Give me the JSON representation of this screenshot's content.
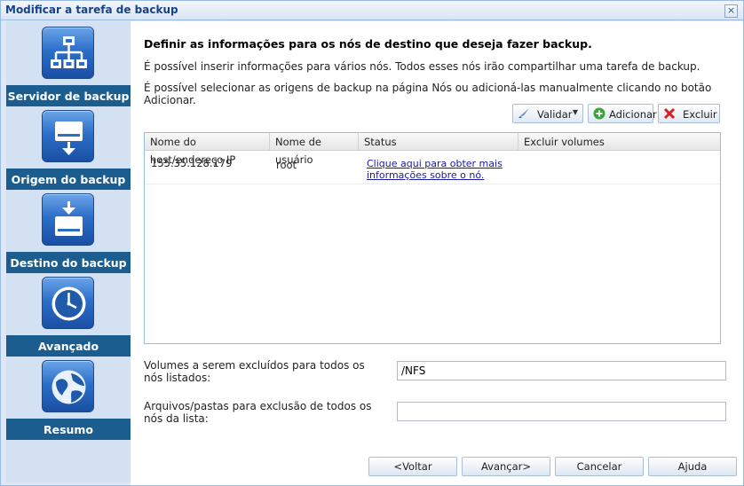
{
  "window": {
    "title": "Modificar a tarefa de backup",
    "close_symbol": "×"
  },
  "sidebar": {
    "steps": [
      {
        "label": "Servidor de backup",
        "icon": "network-icon"
      },
      {
        "label": "Origem do backup",
        "icon": "drive-download-icon"
      },
      {
        "label": "Destino do backup",
        "icon": "drive-upload-icon"
      },
      {
        "label": "Avançado",
        "icon": "clock-icon"
      },
      {
        "label": "Resumo",
        "icon": "globe-icon"
      }
    ]
  },
  "main": {
    "heading": "Definir as informações para os nós de destino que deseja fazer backup.",
    "info1": "É possível inserir informações para vários nós. Todos esses nós irão compartilhar uma tarefa de backup.",
    "info2": "É possível selecionar as origens de backup na página Nós ou adicioná-las manualmente clicando no botão Adicionar."
  },
  "toolbar": {
    "validate": "Validar",
    "add": "Adicionar",
    "delete": "Excluir"
  },
  "grid": {
    "columns": [
      "Nome do host/endereço IP",
      "Nome de usuário",
      "Status",
      "Excluir volumes"
    ],
    "rows": [
      {
        "host": "155.35.128.179",
        "user": "root",
        "status": "Clique aqui para obter mais informações sobre o nó.",
        "exclude": ""
      }
    ]
  },
  "form": {
    "volumes_label": "Volumes a serem excluídos para todos os nós listados:",
    "volumes_value": "/NFS",
    "files_label": "Arquivos/pastas para exclusão de todos os nós da lista:",
    "files_value": ""
  },
  "nav": {
    "back": "<Voltar",
    "next": "Avançar>",
    "cancel": "Cancelar",
    "help": "Ajuda"
  },
  "colors": {
    "accent": "#1b5d8f",
    "link": "#1a1aa8",
    "border": "#99bbe8"
  }
}
